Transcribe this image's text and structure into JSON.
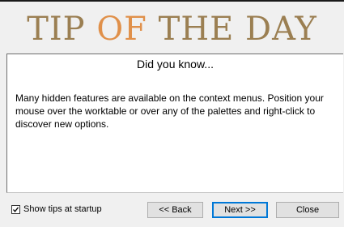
{
  "banner": {
    "title_part1": "TIP ",
    "title_part2": "OF",
    "title_part3": " THE DAY"
  },
  "panel": {
    "heading": "Did you know...",
    "body": "Many hidden features are available on the context menus. Position your mouse over the worktable or over any of the palettes and right-click to discover new options."
  },
  "footer": {
    "checkbox_label": "Show tips at startup",
    "checkbox_checked": true,
    "back_label": "<< Back",
    "next_label": "Next >>",
    "close_label": "Close"
  },
  "colors": {
    "title": "#9b7f52",
    "title_accent": "#e0904a",
    "default_button_border": "#0078d7"
  }
}
